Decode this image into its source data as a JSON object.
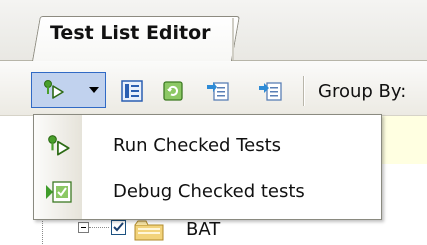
{
  "window": {
    "tab_title": "Test List Editor"
  },
  "toolbar": {
    "group_by_label": "Group By:",
    "buttons": [
      {
        "icon": "run-tests-icon"
      },
      {
        "icon": "test-list-properties-icon"
      },
      {
        "icon": "refresh-icon"
      },
      {
        "icon": "import-tests-icon"
      },
      {
        "icon": "export-tests-icon"
      }
    ]
  },
  "run_menu": {
    "items": [
      {
        "label": "Run Checked Tests",
        "icon": "run-tests-icon"
      },
      {
        "label": "Debug Checked tests",
        "icon": "debug-tests-icon"
      }
    ]
  },
  "tree": {
    "node_label": "BAT",
    "node_checked": true,
    "node_icon": "folder-icon"
  },
  "colors": {
    "selection_border": "#316ac5",
    "selection_fill": "#c1d2ee",
    "info_bar": "#ffffe1"
  }
}
